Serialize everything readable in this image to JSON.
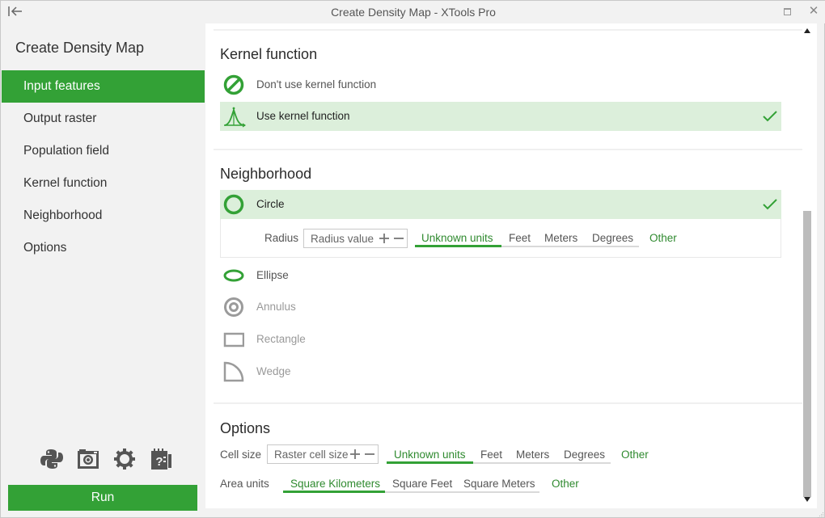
{
  "window": {
    "title": "Create Density Map - XTools Pro",
    "back_icon": "collapse-left-arrow",
    "maximize_icon": "maximize-icon",
    "close_icon": "close-icon",
    "close_glyph": "✕",
    "back_glyph": "|←"
  },
  "sidebar": {
    "title": "Create Density Map",
    "items": [
      {
        "label": "Input features",
        "active": true
      },
      {
        "label": "Output raster",
        "active": false
      },
      {
        "label": "Population field",
        "active": false
      },
      {
        "label": "Kernel function",
        "active": false
      },
      {
        "label": "Neighborhood",
        "active": false
      },
      {
        "label": "Options",
        "active": false
      }
    ],
    "tools": [
      {
        "icon": "python-icon"
      },
      {
        "icon": "camera-icon"
      },
      {
        "icon": "gear-icon"
      },
      {
        "icon": "help-notebook-icon"
      }
    ],
    "run_label": "Run"
  },
  "kernel": {
    "title": "Kernel function",
    "options": [
      {
        "label": "Don't use kernel function",
        "icon": "no-kernel-icon",
        "selected": false
      },
      {
        "label": "Use kernel function",
        "icon": "kernel-curve-icon",
        "selected": true
      }
    ]
  },
  "neighborhood": {
    "title": "Neighborhood",
    "options": [
      {
        "label": "Circle",
        "icon": "circle-icon",
        "selected": true,
        "enabled": true
      },
      {
        "label": "Ellipse",
        "icon": "ellipse-icon",
        "selected": false,
        "enabled": true
      },
      {
        "label": "Annulus",
        "icon": "annulus-icon",
        "selected": false,
        "enabled": false
      },
      {
        "label": "Rectangle",
        "icon": "rectangle-icon",
        "selected": false,
        "enabled": false
      },
      {
        "label": "Wedge",
        "icon": "wedge-icon",
        "selected": false,
        "enabled": false
      }
    ],
    "radius": {
      "label": "Radius",
      "placeholder": "Radius value",
      "value": "",
      "units": [
        "Unknown units",
        "Feet",
        "Meters",
        "Degrees"
      ],
      "selected_unit": "Unknown units",
      "other_label": "Other"
    }
  },
  "options": {
    "title": "Options",
    "cell_size": {
      "label": "Cell size",
      "placeholder": "Raster cell size",
      "value": "",
      "units": [
        "Unknown units",
        "Feet",
        "Meters",
        "Degrees"
      ],
      "selected_unit": "Unknown units",
      "other_label": "Other"
    },
    "area_units": {
      "label": "Area units",
      "units": [
        "Square Kilometers",
        "Square Feet",
        "Square Meters"
      ],
      "selected_unit": "Square Kilometers",
      "other_label": "Other"
    }
  },
  "colors": {
    "accent": "#33a136",
    "selected_row": "#dcefdb",
    "link_green": "#2f8a2f",
    "disabled_icon": "#9b9b9b"
  }
}
